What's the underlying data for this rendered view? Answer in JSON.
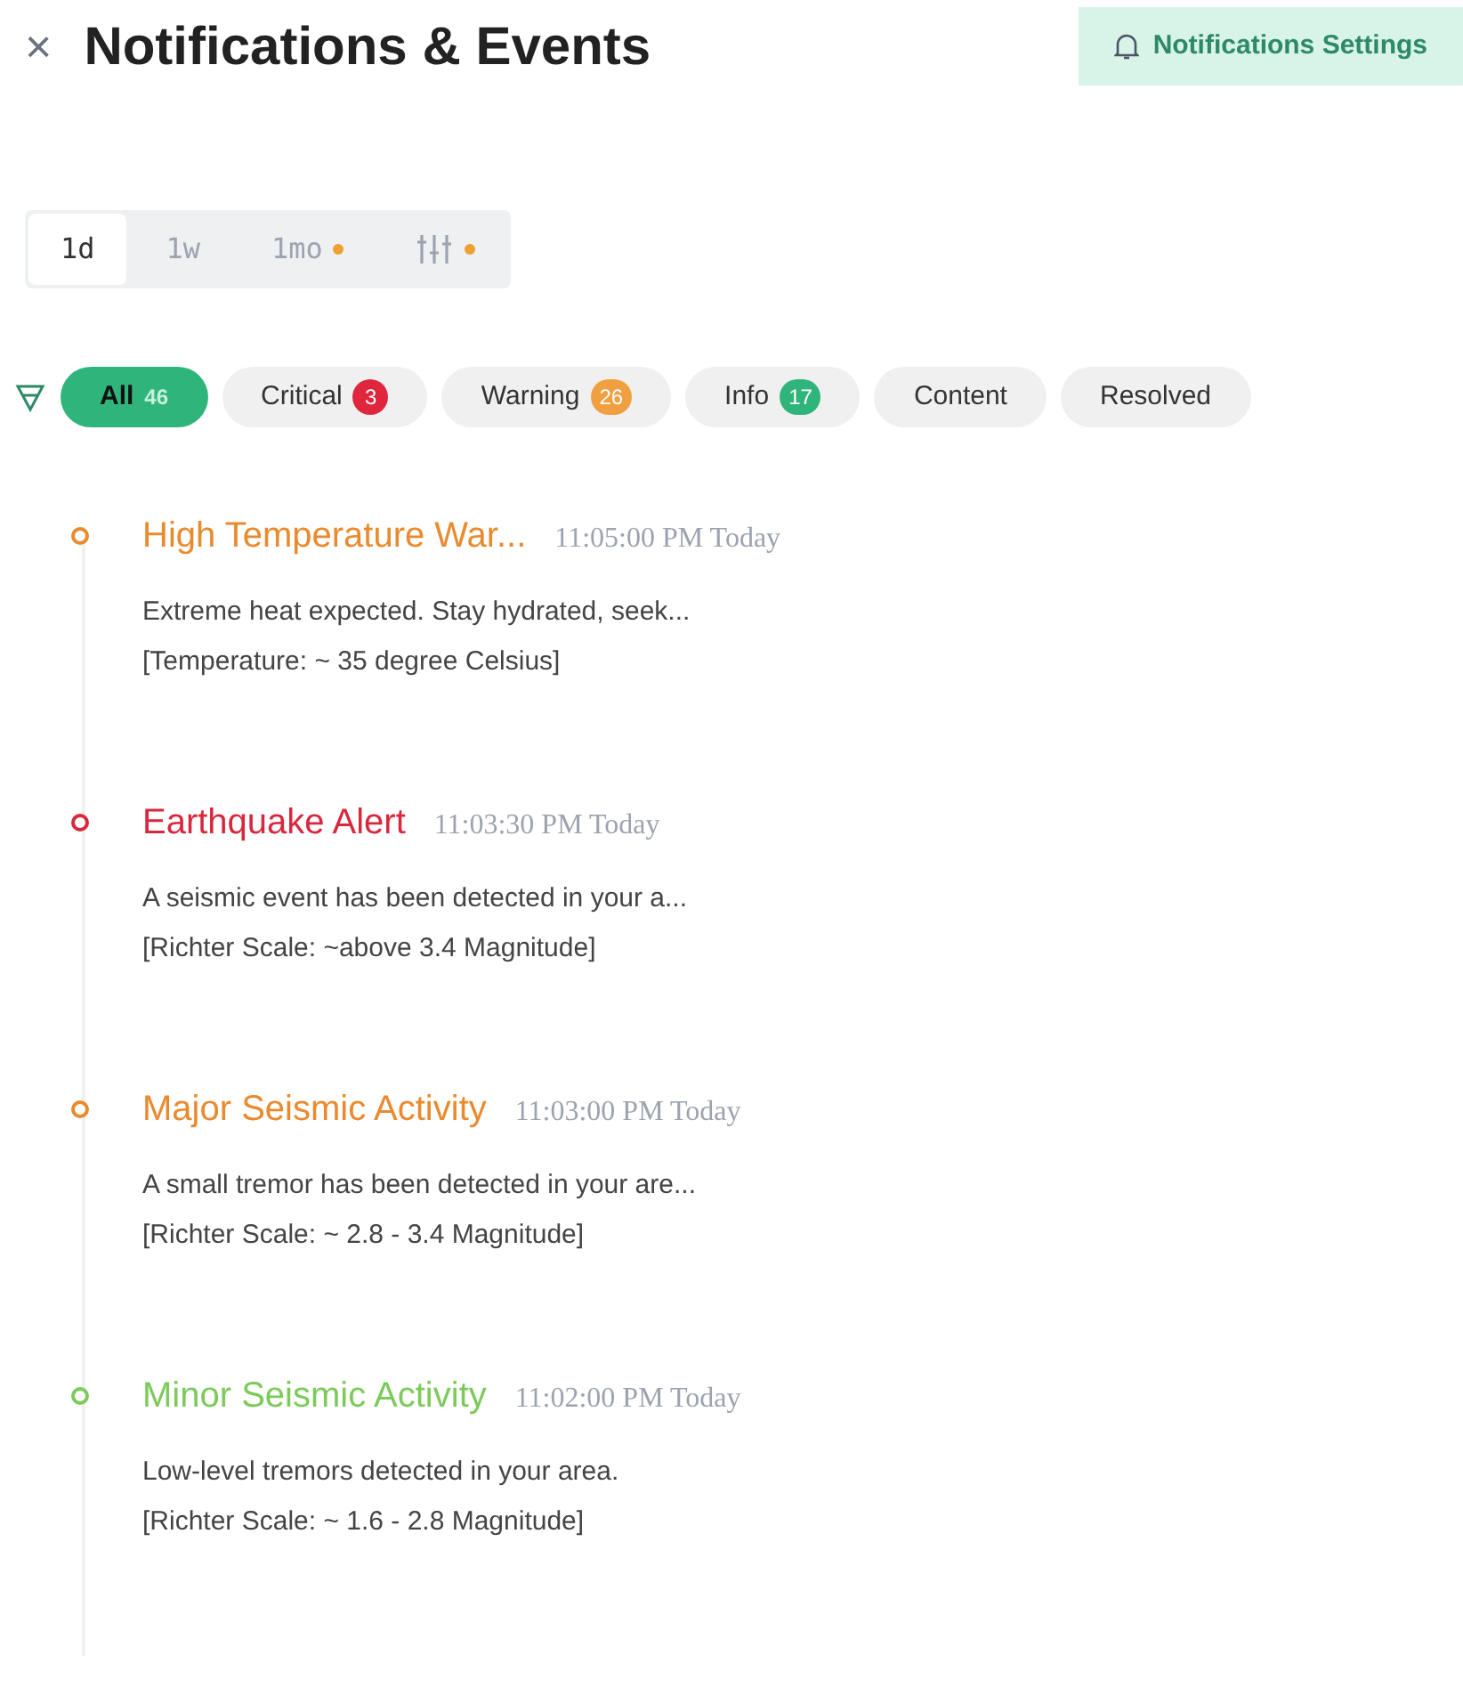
{
  "header": {
    "close": "×",
    "title": "Notifications & Events",
    "settings_button": "Notifications Settings"
  },
  "range_tabs": [
    {
      "kind": "text",
      "label": "1d",
      "selected": true,
      "dot": false
    },
    {
      "kind": "text",
      "label": "1w",
      "selected": false,
      "dot": false
    },
    {
      "kind": "text",
      "label": "1mo",
      "selected": false,
      "dot": true
    },
    {
      "kind": "icon",
      "selected": false,
      "dot": true
    }
  ],
  "filters": [
    {
      "label": "All",
      "count": "46",
      "selected": true
    },
    {
      "label": "Critical",
      "count": "3",
      "selected": false,
      "color": "#e0263c"
    },
    {
      "label": "Warning",
      "count": "26",
      "selected": false,
      "color": "#f0a040"
    },
    {
      "label": "Info",
      "count": "17",
      "selected": false,
      "color": "#2fb57c"
    },
    {
      "label": "Content",
      "selected": false
    },
    {
      "label": "Resolved",
      "selected": false
    }
  ],
  "events": [
    {
      "title": "High Temperature War...",
      "time": "11:05:00 PM Today",
      "color": "#ea8a2e",
      "lines": [
        "Extreme heat expected. Stay hydrated, seek...",
        "[Temperature: ~ 35 degree Celsius]"
      ]
    },
    {
      "title": "Earthquake Alert",
      "time": "11:03:30 PM Today",
      "color": "#d8283e",
      "lines": [
        "A seismic event has been detected in your a...",
        "[Richter Scale: ~above 3.4 Magnitude]"
      ]
    },
    {
      "title": "Major Seismic Activity",
      "time": "11:03:00 PM Today",
      "color": "#ea8a2e",
      "lines": [
        "A small tremor has been detected in your are...",
        "[Richter Scale: ~ 2.8 - 3.4 Magnitude]"
      ]
    },
    {
      "title": "Minor Seismic Activity",
      "time": "11:02:00 PM Today",
      "color": "#7ccb5a",
      "lines": [
        "Low-level tremors detected in your area.",
        "[Richter Scale: ~ 1.6 - 2.8 Magnitude]"
      ]
    }
  ]
}
